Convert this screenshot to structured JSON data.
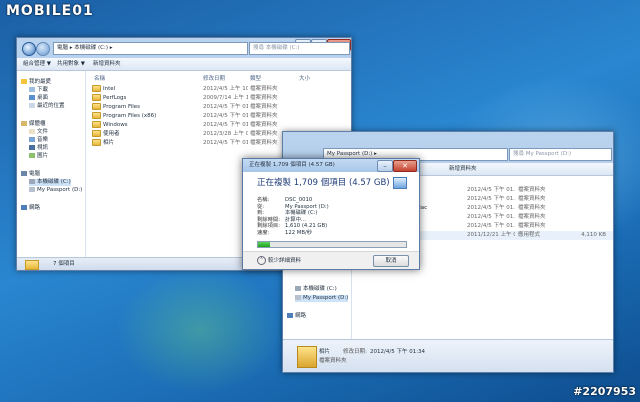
{
  "branding": {
    "logo": "MOBILE01",
    "watermark": "#2207953"
  },
  "window1": {
    "breadcrumb": [
      "電腦",
      "本機磁碟 (C:)"
    ],
    "search_placeholder": "搜尋 本機磁碟 (C:)",
    "toolbar": [
      "組合管理 ▼",
      "共用對象 ▼",
      "新增資料夾"
    ],
    "columns": [
      "名稱",
      "修改日期",
      "類型",
      "大小"
    ],
    "files": [
      {
        "name": "Intel",
        "date": "2012/4/5 上午 10...",
        "type": "檔案資料夾"
      },
      {
        "name": "PerfLogs",
        "date": "2009/7/14 上午 1...",
        "type": "檔案資料夾"
      },
      {
        "name": "Program Files",
        "date": "2012/4/5 下午 01...",
        "type": "檔案資料夾"
      },
      {
        "name": "Program Files (x86)",
        "date": "2012/4/5 下午 01...",
        "type": "檔案資料夾"
      },
      {
        "name": "Windows",
        "date": "2012/4/5 下午 01...",
        "type": "檔案資料夾"
      },
      {
        "name": "使用者",
        "date": "2012/3/28 上午 0...",
        "type": "檔案資料夾"
      },
      {
        "name": "相片",
        "date": "2012/4/5 下午 01...",
        "type": "檔案資料夾"
      }
    ],
    "nav": {
      "favorites": "我的最愛",
      "fav_items": [
        "下載",
        "桌面",
        "最近的位置"
      ],
      "library": "媒體櫃",
      "lib_items": [
        "文件",
        "音樂",
        "視訊",
        "圖片"
      ],
      "computer": "電腦",
      "comp_items": [
        "本機磁碟 (C:)",
        "My Passport (D:)"
      ],
      "network": "網路"
    },
    "status": "7 個項目"
  },
  "window2": {
    "breadcrumb": [
      "My Passport (D:)"
    ],
    "search_placeholder": "搜尋 My Passport (D:)",
    "toolbar": [
      "新增資料夾"
    ],
    "files": [
      {
        "name": "",
        "date": "2012/4/5 下午 01...",
        "type": "檔案資料夾",
        "size": ""
      },
      {
        "name": "",
        "date": "2012/4/5 下午 01...",
        "type": "檔案資料夾",
        "size": ""
      },
      {
        "name": "Mac",
        "date": "2012/4/5 下午 01...",
        "type": "檔案資料夾",
        "size": ""
      },
      {
        "name": "",
        "date": "2012/4/5 下午 01...",
        "type": "檔案資料夾",
        "size": ""
      },
      {
        "name": "",
        "date": "2012/4/5 下午 01...",
        "type": "檔案資料夾",
        "size": ""
      },
      {
        "name": "",
        "date": "2011/12/21 上午 0...",
        "type": "應用程式",
        "size": "4,110 KB"
      }
    ],
    "nav": {
      "comp_items": [
        "本機磁碟 (C:)",
        "My Passport (D:)"
      ],
      "network": "網路"
    },
    "details": {
      "name": "相片",
      "label": "修改日期:",
      "date": "2012/4/5 下午 01:34",
      "type": "檔案資料夾"
    }
  },
  "dialog": {
    "title": "正在複製 1,709 個項目 (4.57 GB)",
    "heading": "正在複製 1,709 個項目 (4.57 GB)",
    "fields": [
      {
        "k": "名稱:",
        "v": "DSC_0010"
      },
      {
        "k": "從:",
        "v": "My Passport (D:)"
      },
      {
        "k": "到:",
        "v": "本機磁碟 (C:)"
      },
      {
        "k": "剩餘時間:",
        "v": "計算中..."
      },
      {
        "k": "剩餘項目:",
        "v": "1,610 (4.21 GB)"
      },
      {
        "k": "速度:",
        "v": "122 MB/秒"
      }
    ],
    "progress": 0.08,
    "less_info": "較少詳細資料",
    "cancel": "取消"
  }
}
